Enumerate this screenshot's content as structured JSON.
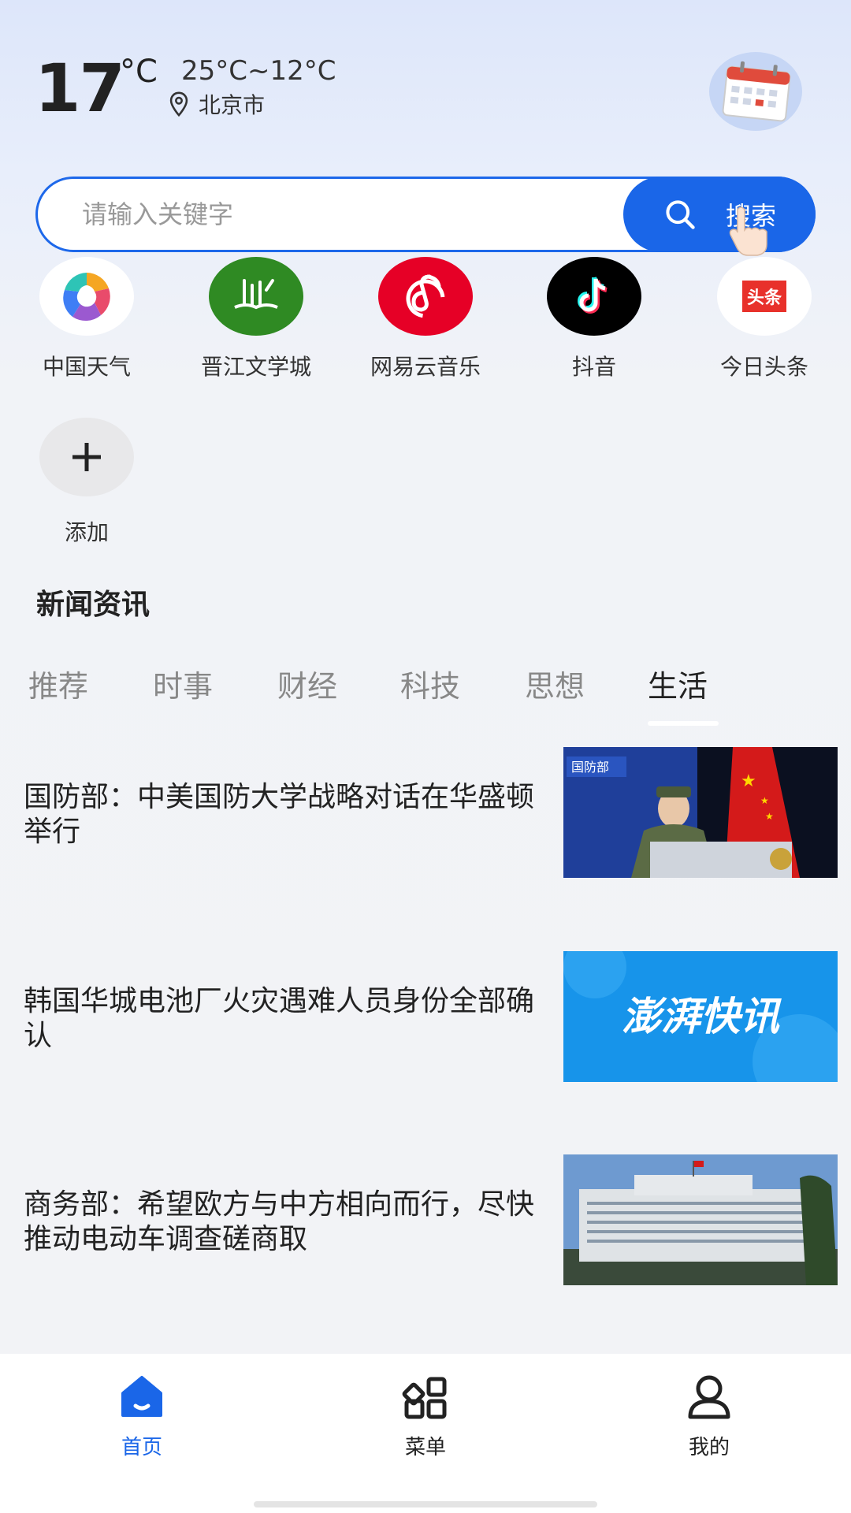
{
  "weather": {
    "temperature": "17",
    "unit": "°C",
    "range": "25°C~12°C",
    "location": "北京市"
  },
  "icons": {
    "location": "location-pin-icon",
    "calendar": "calendar-icon",
    "search": "search-icon",
    "add": "plus-icon"
  },
  "search": {
    "placeholder": "请输入关键字",
    "button_label": "搜索"
  },
  "shortcuts": [
    {
      "label": "中国天气"
    },
    {
      "label": "晋江文学城"
    },
    {
      "label": "网易云音乐"
    },
    {
      "label": "抖音"
    },
    {
      "label": "今日头条",
      "badge": "头条"
    }
  ],
  "add_label": "添加",
  "news_section": {
    "title": "新闻资讯",
    "tabs": [
      "推荐",
      "时事",
      "财经",
      "科技",
      "思想",
      "生活"
    ],
    "active_tab": "生活",
    "items": [
      {
        "title": "国防部：中美国防大学战略对话在华盛顿举行",
        "image_text": "国防部"
      },
      {
        "title": "韩国华城电池厂火灾遇难人员身份全部确认",
        "image_text": "澎湃快讯"
      },
      {
        "title": "商务部：希望欧方与中方相向而行，尽快推动电动车调查磋商取",
        "image_text": ""
      }
    ]
  },
  "bottom_nav": [
    {
      "label": "首页",
      "icon": "home-icon",
      "active": true
    },
    {
      "label": "菜单",
      "icon": "grid-menu-icon",
      "active": false
    },
    {
      "label": "我的",
      "icon": "user-icon",
      "active": false
    }
  ],
  "colors": {
    "accent": "#1a66e8",
    "background": "#f2f3f6"
  }
}
